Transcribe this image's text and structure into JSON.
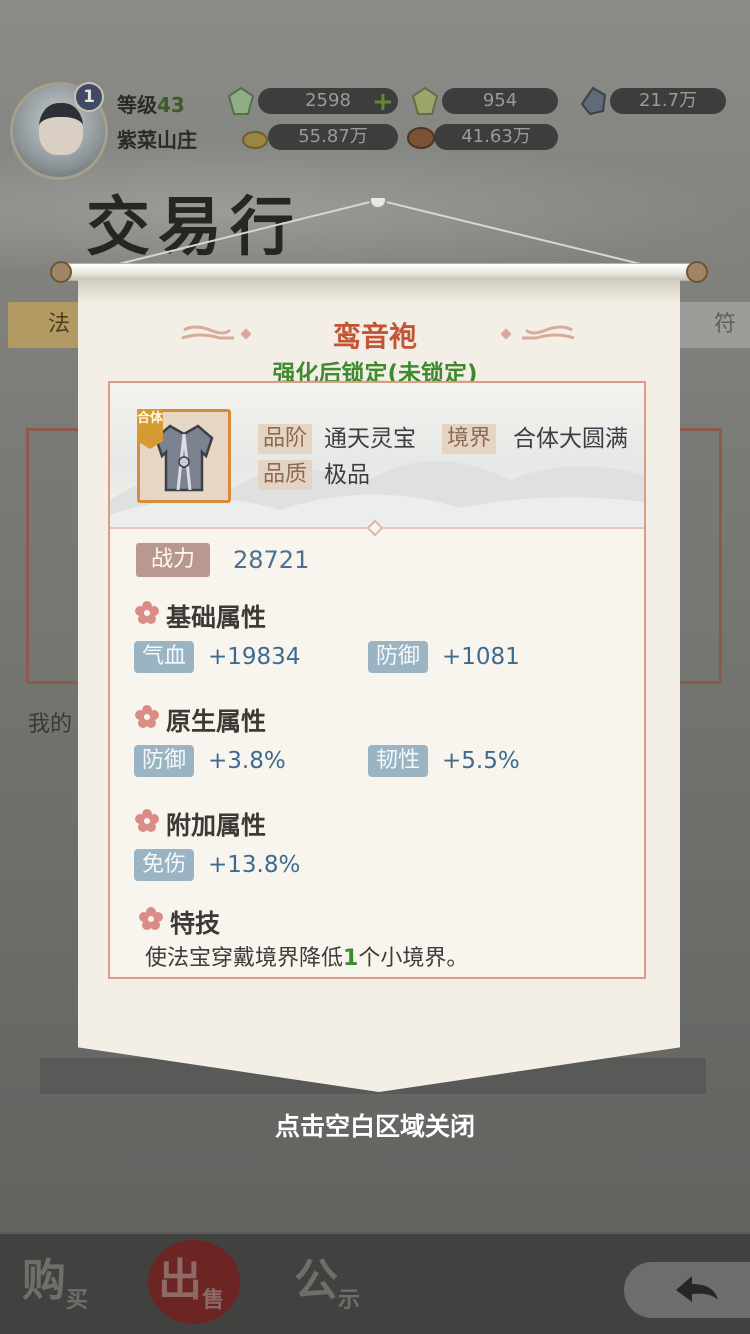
{
  "player": {
    "level_label": "等级",
    "level": "43",
    "sect": "紫菜山庄"
  },
  "resources": {
    "spirit_stone_low": "2598",
    "spirit_stone_mid": "954",
    "ore": "21.7万",
    "gold": "55.87万",
    "wood": "41.63万"
  },
  "page": {
    "title": "交易行",
    "tab_left": "法",
    "tab_right": "符",
    "my_label": "我的"
  },
  "bottom_nav": {
    "buy_big": "购",
    "buy_small": "买",
    "sell_big": "出",
    "sell_small": "售",
    "notice_big": "公",
    "notice_small": "示"
  },
  "item": {
    "name": "鸾音袍",
    "lock_status": "强化后锁定(未锁定)",
    "merge_tag": "合体",
    "grade_label": "品阶",
    "grade": "通天灵宝",
    "realm_label": "境界",
    "realm": "合体大圆满",
    "quality_label": "品质",
    "quality": "极品",
    "power_label": "战力",
    "power": "28721"
  },
  "sections": {
    "basic": "基础属性",
    "native": "原生属性",
    "extra": "附加属性",
    "skill": "特技"
  },
  "stats": {
    "basic": [
      {
        "name": "气血",
        "value": "+19834"
      },
      {
        "name": "防御",
        "value": "+1081"
      }
    ],
    "native": [
      {
        "name": "防御",
        "value": "+3.8%"
      },
      {
        "name": "韧性",
        "value": "+5.5%"
      }
    ],
    "extra": [
      {
        "name": "免伤",
        "value": "+13.8%"
      }
    ]
  },
  "skill": {
    "prefix": "使法宝穿戴境界降低",
    "number": "1",
    "suffix": "个小境界。"
  },
  "close_hint": "点击空白区域关闭",
  "colors": {
    "item_name": "#c35536",
    "lock_status": "#3f8a2e",
    "stat_value": "#3f6a8f",
    "stat_tag": "#9ab4c3",
    "power_tag": "#b9998f"
  }
}
